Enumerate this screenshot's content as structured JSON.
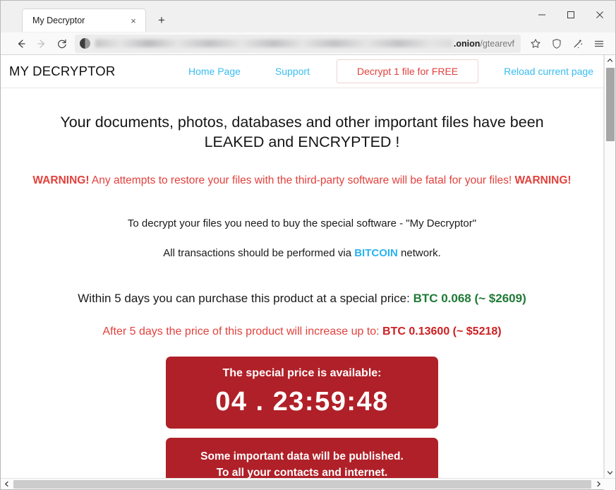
{
  "browser": {
    "tab": {
      "title": "My Decryptor",
      "close_label": "×"
    },
    "new_tab_label": "+",
    "window_controls": {
      "minimize": "–",
      "maximize": "□",
      "close": "✕"
    },
    "nav": {
      "back": "back-arrow",
      "forward": "forward-arrow",
      "reload": "reload-arrow"
    },
    "url": {
      "blurred_prefix": "",
      "domain": ".onion",
      "path": "/gtearevf"
    },
    "toolbar_icons": [
      "bookmark-star",
      "shield",
      "sparkle-wand",
      "menu-hamburger"
    ]
  },
  "page": {
    "brand": "MY DECRYPTOR",
    "nav_links": [
      {
        "label": "Home Page"
      },
      {
        "label": "Support"
      },
      {
        "label": "Decrypt 1 file for FREE"
      },
      {
        "label": "Reload current page"
      }
    ],
    "heading_line1": "Your documents, photos, databases and other important files have been",
    "heading_line2": "LEAKED and ENCRYPTED !",
    "warning": {
      "prefix": "WARNING!",
      "middle": " Any attempts to restore your files with the third-party software will be fatal for your files! ",
      "suffix": "WARNING!"
    },
    "info_line1": "To decrypt your files you need to buy the special software - \"My Decryptor\"",
    "info_line2": {
      "before": "All transactions should be performed via ",
      "highlight": "BITCOIN",
      "after": " network."
    },
    "special_price": {
      "text": "Within 5 days you can purchase this product at a special price: ",
      "value": "BTC 0.068 (~ $2609)"
    },
    "increased_price": {
      "text": "After 5 days the price of this product will increase up to: ",
      "value": "BTC 0.13600 (~ $5218)"
    },
    "countdown": {
      "title": "The special price is available:",
      "value": "04 . 23:59:48"
    },
    "publish_warning": {
      "line1": "Some important data will be published.",
      "line2": "To all your contacts and internet.",
      "line3_clipped": ""
    }
  },
  "colors": {
    "link": "#38bdf0",
    "danger": "#e2413c",
    "price_green": "#1f7a35",
    "price_red": "#cc1f22",
    "box_red": "#b02028",
    "bitcoin": "#2ab3ef"
  }
}
